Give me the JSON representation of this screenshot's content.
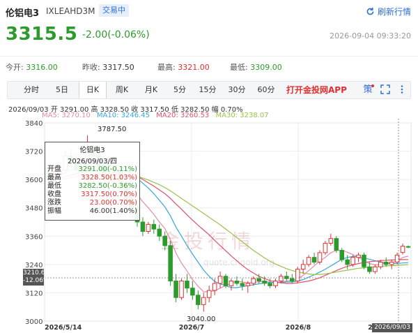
{
  "header": {
    "name": "伦铝电3",
    "code": "IXLEAHD3M",
    "status": "交易中",
    "refresh_label": "刷新行情"
  },
  "quote": {
    "price": "3315.5",
    "change": "-2.00(-0.06%)",
    "timestamp": "2026-09-04 09:33:20"
  },
  "stats": [
    {
      "label": "今开:",
      "value": "3316.00",
      "color": "green"
    },
    {
      "label": "昨收:",
      "value": "3317.50",
      "color": "neutral"
    },
    {
      "label": "最高:",
      "value": "3321.00",
      "color": "red"
    },
    {
      "label": "最低:",
      "value": "3309.00",
      "color": "green"
    }
  ],
  "tabs": [
    "分时",
    "5日",
    "日K",
    "周K",
    "月K",
    "5分",
    "15分",
    "30分",
    "60分"
  ],
  "active_tab": "日K",
  "promo": "打开金投网APP",
  "toolbar": {
    "strategy_label": "策"
  },
  "ohlc_line": "2026/09/03  开 3291.00  高 3328.50  收 3317.50  低 3282.50  幅 0.70%",
  "ma": [
    {
      "label": "MA5: 3270.10",
      "color": "#e88aa8"
    },
    {
      "label": "MA10: 3246.45",
      "color": "#37a7d9"
    },
    {
      "label": "MA20: 3260.53",
      "color": "#e0506a"
    },
    {
      "label": "MA30: 3238.07",
      "color": "#9ac24a"
    }
  ],
  "tooltip": {
    "title": "伦铝电3",
    "date": "2026/09/03/四",
    "rows": [
      {
        "k": "开盘",
        "v": "3291.00(-0.11%)",
        "color": "green"
      },
      {
        "k": "最高",
        "v": "3328.50(1.03%)",
        "color": "red"
      },
      {
        "k": "最低",
        "v": "3282.50(-0.36%)",
        "color": "green"
      },
      {
        "k": "收盘",
        "v": "3317.50(0.70%)",
        "color": "red"
      },
      {
        "k": "涨跌",
        "v": "23.00(0.70%)",
        "color": "red"
      },
      {
        "k": "振幅",
        "v": "46.00(1.40%)",
        "color": "neutral"
      }
    ]
  },
  "cursor": {
    "price": "3210.62",
    "pct": "-12.06%",
    "date": "2026/09/03"
  },
  "watermark": {
    "text": "金投行情",
    "sub": "quote.cngold.org"
  },
  "chart_data": {
    "type": "candlestick",
    "ylim": [
      3000,
      3840
    ],
    "y_ticks": [
      3000,
      3120,
      3240,
      3360,
      3480,
      3600,
      3720,
      3840
    ],
    "x_tick_labels": [
      "2026/5/14",
      "2026/7",
      "2026/8",
      "2026/09/03"
    ],
    "annotations": [
      {
        "label": "3787.50"
      },
      {
        "label": "3040.00"
      }
    ],
    "colors": {
      "up": "#e03030",
      "down": "#2d9a2d"
    },
    "candles": [
      [
        3630,
        3650,
        3585,
        3600
      ],
      [
        3600,
        3640,
        3590,
        3625
      ],
      [
        3625,
        3660,
        3610,
        3640
      ],
      [
        3640,
        3720,
        3630,
        3700
      ],
      [
        3700,
        3730,
        3650,
        3670
      ],
      [
        3670,
        3700,
        3620,
        3640
      ],
      [
        3640,
        3690,
        3630,
        3680
      ],
      [
        3680,
        3787.5,
        3670,
        3740
      ],
      [
        3740,
        3760,
        3690,
        3700
      ],
      [
        3700,
        3720,
        3640,
        3660
      ],
      [
        3660,
        3680,
        3600,
        3620
      ],
      [
        3620,
        3640,
        3570,
        3600
      ],
      [
        3600,
        3650,
        3590,
        3630
      ],
      [
        3630,
        3650,
        3560,
        3580
      ],
      [
        3580,
        3600,
        3500,
        3520
      ],
      [
        3520,
        3540,
        3460,
        3480
      ],
      [
        3480,
        3500,
        3400,
        3420
      ],
      [
        3420,
        3440,
        3360,
        3380
      ],
      [
        3380,
        3420,
        3370,
        3410
      ],
      [
        3410,
        3430,
        3370,
        3390
      ],
      [
        3390,
        3410,
        3340,
        3360
      ],
      [
        3360,
        3380,
        3300,
        3320
      ],
      [
        3320,
        3340,
        3150,
        3170
      ],
      [
        3170,
        3200,
        3080,
        3100
      ],
      [
        3100,
        3180,
        3090,
        3170
      ],
      [
        3170,
        3200,
        3120,
        3140
      ],
      [
        3140,
        3170,
        3090,
        3110
      ],
      [
        3110,
        3130,
        3050,
        3070
      ],
      [
        3070,
        3120,
        3040,
        3100
      ],
      [
        3100,
        3150,
        3080,
        3130
      ],
      [
        3130,
        3180,
        3110,
        3160
      ],
      [
        3160,
        3210,
        3140,
        3190
      ],
      [
        3190,
        3200,
        3140,
        3150
      ],
      [
        3150,
        3180,
        3130,
        3170
      ],
      [
        3170,
        3190,
        3150,
        3160
      ],
      [
        3160,
        3180,
        3130,
        3150
      ],
      [
        3150,
        3170,
        3120,
        3160
      ],
      [
        3160,
        3190,
        3150,
        3180
      ],
      [
        3180,
        3200,
        3160,
        3170
      ],
      [
        3170,
        3190,
        3150,
        3160
      ],
      [
        3160,
        3180,
        3140,
        3150
      ],
      [
        3150,
        3180,
        3140,
        3170
      ],
      [
        3170,
        3200,
        3160,
        3190
      ],
      [
        3190,
        3210,
        3170,
        3180
      ],
      [
        3180,
        3200,
        3160,
        3170
      ],
      [
        3170,
        3230,
        3160,
        3220
      ],
      [
        3220,
        3260,
        3200,
        3240
      ],
      [
        3240,
        3280,
        3230,
        3270
      ],
      [
        3270,
        3290,
        3240,
        3250
      ],
      [
        3250,
        3300,
        3240,
        3290
      ],
      [
        3290,
        3340,
        3280,
        3330
      ],
      [
        3330,
        3370,
        3320,
        3350
      ],
      [
        3350,
        3360,
        3290,
        3300
      ],
      [
        3300,
        3310,
        3250,
        3260
      ],
      [
        3260,
        3280,
        3220,
        3240
      ],
      [
        3240,
        3280,
        3230,
        3270
      ],
      [
        3270,
        3290,
        3250,
        3280
      ],
      [
        3280,
        3290,
        3220,
        3230
      ],
      [
        3230,
        3250,
        3200,
        3210
      ],
      [
        3210,
        3240,
        3200,
        3230
      ],
      [
        3230,
        3260,
        3220,
        3250
      ],
      [
        3250,
        3270,
        3230,
        3240
      ],
      [
        3240,
        3260,
        3220,
        3250
      ],
      [
        3250,
        3290,
        3240,
        3280
      ],
      [
        3291,
        3328.5,
        3282.5,
        3317.5
      ],
      [
        3316,
        3321,
        3309,
        3315.5
      ]
    ],
    "ma_series": [
      {
        "name": "MA5",
        "color": "#e88aa8",
        "values": [
          3610,
          3618,
          3632,
          3650,
          3665,
          3672,
          3676,
          3686,
          3692,
          3688,
          3676,
          3660,
          3648,
          3624,
          3598,
          3568,
          3536,
          3506,
          3480,
          3452,
          3420,
          3392,
          3346,
          3288,
          3246,
          3212,
          3176,
          3148,
          3124,
          3126,
          3128,
          3140,
          3150,
          3160,
          3170,
          3166,
          3162,
          3164,
          3166,
          3168,
          3166,
          3162,
          3166,
          3170,
          3172,
          3178,
          3194,
          3214,
          3234,
          3254,
          3270,
          3290,
          3300,
          3300,
          3292,
          3282,
          3270,
          3256,
          3244,
          3238,
          3242,
          3246,
          3248,
          3254,
          3270,
          3275
        ]
      },
      {
        "name": "MA10",
        "color": "#37a7d9",
        "values": [
          3605,
          3608,
          3616,
          3628,
          3640,
          3650,
          3660,
          3670,
          3678,
          3680,
          3676,
          3668,
          3660,
          3654,
          3644,
          3628,
          3606,
          3584,
          3564,
          3540,
          3512,
          3484,
          3446,
          3398,
          3360,
          3320,
          3284,
          3250,
          3216,
          3190,
          3168,
          3158,
          3150,
          3142,
          3142,
          3146,
          3150,
          3154,
          3158,
          3162,
          3164,
          3164,
          3164,
          3166,
          3166,
          3170,
          3176,
          3186,
          3196,
          3208,
          3220,
          3234,
          3248,
          3262,
          3270,
          3274,
          3272,
          3268,
          3262,
          3256,
          3250,
          3246,
          3244,
          3244,
          3246.45,
          3248
        ]
      },
      {
        "name": "MA20",
        "color": "#e0506a",
        "values": [
          3600,
          3602,
          3606,
          3612,
          3618,
          3624,
          3630,
          3636,
          3640,
          3642,
          3644,
          3644,
          3642,
          3640,
          3634,
          3626,
          3614,
          3600,
          3586,
          3572,
          3556,
          3540,
          3520,
          3496,
          3474,
          3450,
          3428,
          3406,
          3386,
          3366,
          3342,
          3320,
          3298,
          3276,
          3256,
          3236,
          3218,
          3204,
          3190,
          3180,
          3172,
          3166,
          3162,
          3160,
          3160,
          3162,
          3166,
          3170,
          3176,
          3184,
          3194,
          3204,
          3214,
          3224,
          3232,
          3238,
          3244,
          3248,
          3252,
          3254,
          3256,
          3258,
          3259,
          3260,
          3260.53,
          3261
        ]
      },
      {
        "name": "MA30",
        "color": "#9ac24a",
        "values": [
          3595,
          3597,
          3600,
          3604,
          3608,
          3612,
          3616,
          3620,
          3624,
          3626,
          3628,
          3628,
          3628,
          3626,
          3624,
          3620,
          3614,
          3606,
          3598,
          3588,
          3578,
          3566,
          3552,
          3536,
          3520,
          3504,
          3488,
          3472,
          3456,
          3440,
          3424,
          3408,
          3390,
          3372,
          3354,
          3336,
          3318,
          3300,
          3284,
          3268,
          3254,
          3242,
          3232,
          3222,
          3214,
          3208,
          3204,
          3200,
          3198,
          3198,
          3200,
          3204,
          3208,
          3212,
          3216,
          3220,
          3224,
          3226,
          3228,
          3230,
          3232,
          3234,
          3235,
          3236,
          3238.07,
          3239
        ]
      }
    ]
  }
}
